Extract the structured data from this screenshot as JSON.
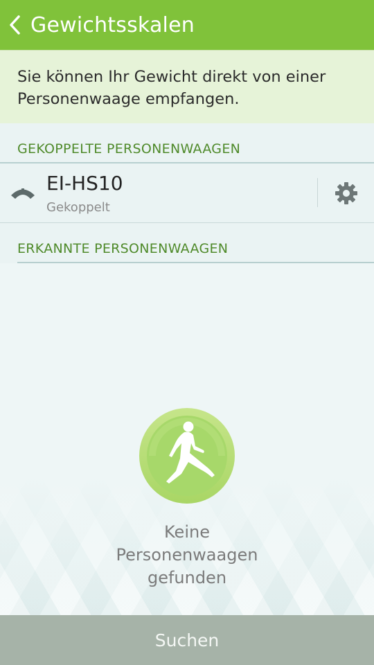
{
  "appbar": {
    "title": "Gewichtsskalen",
    "back_icon": "chevron-left-icon"
  },
  "info": {
    "text": "Sie können Ihr Gewicht direkt von einer Personenwaage empfangen."
  },
  "paired_section": {
    "header": "GEKOPPELTE PERSONENWAAGEN",
    "devices": [
      {
        "name": "EI-HS10",
        "status": "Gekoppelt",
        "icon": "scale-icon",
        "action_icon": "gear-icon"
      }
    ]
  },
  "detected_section": {
    "header": "ERKANNTE PERSONENWAAGEN",
    "empty_icon": "runner-icon",
    "empty_lines": [
      "Keine",
      "Personenwaagen",
      "gefunden"
    ]
  },
  "footer": {
    "button_label": "Suchen"
  },
  "colors": {
    "accent": "#80c23a",
    "section_text": "#4f8a2a",
    "banner_bg": "#e6f3d8",
    "footer_bg": "#a6b3a8"
  }
}
